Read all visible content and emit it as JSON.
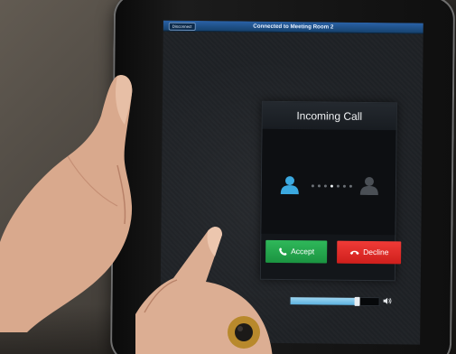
{
  "screen": {
    "title": "Connected to Meeting Room 2",
    "disconnect_label": "Disconnect"
  },
  "call": {
    "header": "Incoming Call",
    "accept_label": "Accept",
    "decline_label": "Decline",
    "caller_color": "#3ba9e0",
    "callee_color": "#4a4f55",
    "progress_dots": 7,
    "active_dot": 3
  },
  "volume": {
    "level": 0.75,
    "icon": "speaker-icon"
  },
  "colors": {
    "accept": "#27a84d",
    "decline": "#e2302c",
    "titlebar": "#1f4f86"
  },
  "icons": {
    "caller": "person-icon",
    "callee": "person-icon",
    "accept": "phone-icon",
    "decline": "hangup-icon"
  }
}
